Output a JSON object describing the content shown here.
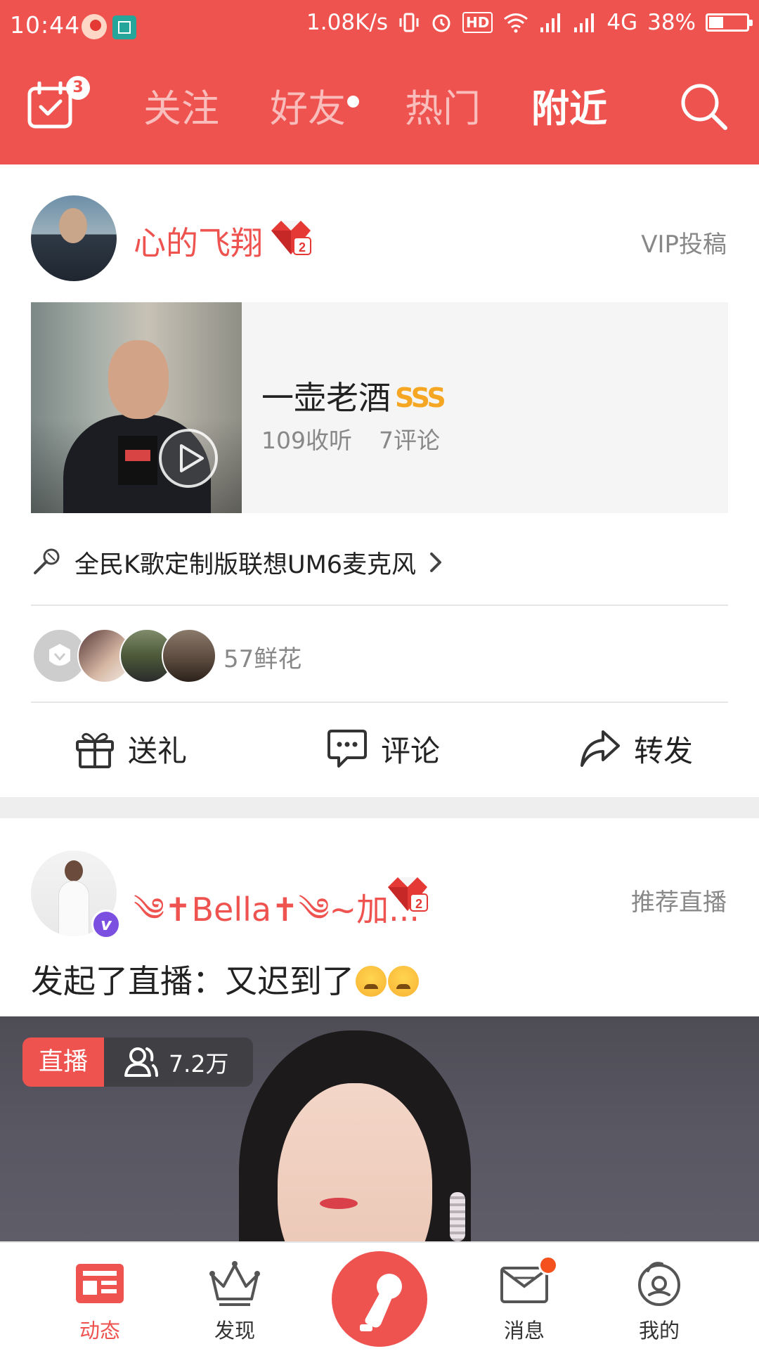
{
  "status_bar": {
    "time": "10:44",
    "net_speed": "1.08K/s",
    "hd": "HD",
    "network": "4G",
    "battery": "38%",
    "battery_level": 0.38
  },
  "top_nav": {
    "calendar_badge": "3",
    "tabs": [
      {
        "label": "关注",
        "active": false
      },
      {
        "label": "好友",
        "active": false,
        "dot": true
      },
      {
        "label": "热门",
        "active": false
      },
      {
        "label": "附近",
        "active": true
      }
    ]
  },
  "post1": {
    "username": "心的飞翔",
    "tag": "VIP投稿",
    "song": {
      "title": "一壶老酒",
      "rating": "SSS",
      "listens": "109收听",
      "comments": "7评论"
    },
    "promo": "全民K歌定制版联想UM6麦克风",
    "flowers": "57鲜花",
    "actions": {
      "gift": "送礼",
      "comment": "评论",
      "share": "转发"
    }
  },
  "post2": {
    "username": "༄✝Bella✝༄~加...",
    "tag": "推荐直播",
    "text": "发起了直播：又迟到了",
    "live_label": "直播",
    "viewers": "7.2万"
  },
  "bottom_nav": {
    "items": [
      {
        "label": "动态",
        "active": true
      },
      {
        "label": "发现",
        "active": false
      },
      {
        "label": "消息",
        "active": false
      },
      {
        "label": "我的",
        "active": false
      }
    ]
  },
  "colors": {
    "accent": "#ef5350",
    "gold": "#f5a623",
    "verified": "#7b4fe0"
  }
}
